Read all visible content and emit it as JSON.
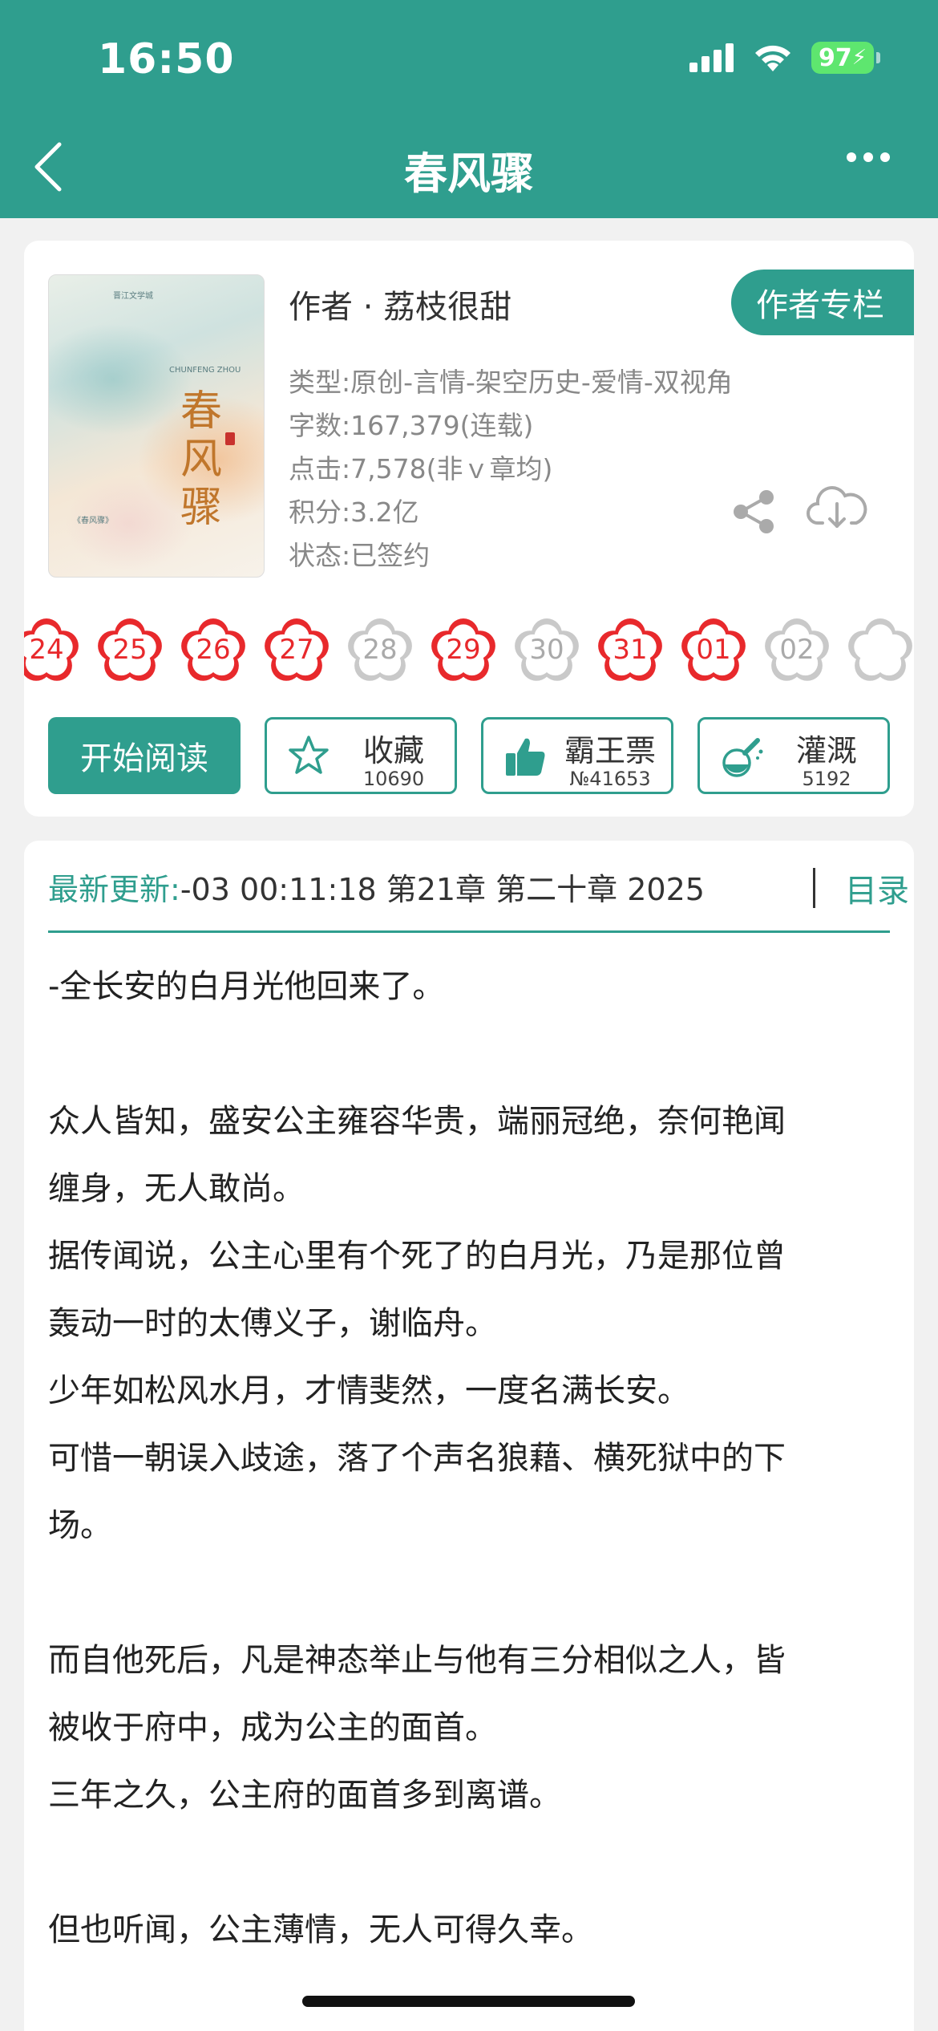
{
  "status_bar": {
    "time": "16:50",
    "battery": "97"
  },
  "nav": {
    "title": "春风骤"
  },
  "cover": {
    "title_chars": [
      "春",
      "风",
      "骤"
    ],
    "tiny_text_1": "晋江文学城",
    "tiny_text_2": "CHUNFENG ZHOU",
    "tiny_text_3": "《春风骤》"
  },
  "book": {
    "author": "作者 · 荔枝很甜",
    "author_tag": "作者专栏",
    "meta": [
      "类型:原创-言情-架空历史-爱情-双视角",
      "字数:167,379(连载)",
      "点击:7,578(非ｖ章均)",
      "积分:3.2亿",
      "状态:已签约"
    ]
  },
  "calendar": [
    {
      "day": "24",
      "active": true
    },
    {
      "day": "25",
      "active": true
    },
    {
      "day": "26",
      "active": true
    },
    {
      "day": "27",
      "active": true
    },
    {
      "day": "28",
      "active": false
    },
    {
      "day": "29",
      "active": true
    },
    {
      "day": "30",
      "active": false
    },
    {
      "day": "31",
      "active": true
    },
    {
      "day": "01",
      "active": true
    },
    {
      "day": "02",
      "active": false
    }
  ],
  "actions": {
    "read": "开始阅读",
    "collect": {
      "label": "收藏",
      "count": "10690"
    },
    "ticket": {
      "label": "霸王票",
      "count": "№41653"
    },
    "water": {
      "label": "灌溉",
      "count": "5192"
    }
  },
  "update": {
    "label": "最新更新:",
    "text": "-03 00:11:18   第21章 第二十章 2025",
    "toc": "目录"
  },
  "intro": [
    "-全长安的白月光他回来了。",
    "",
    "众人皆知，盛安公主雍容华贵，端丽冠绝，奈何艳闻",
    "缠身，无人敢尚。",
    "据传闻说，公主心里有个死了的白月光，乃是那位曾",
    "轰动一时的太傅义子，谢临舟。",
    "少年如松风水月，才情斐然，一度名满长安。",
    "可惜一朝误入歧途，落了个声名狼藉、横死狱中的下",
    "场。",
    "",
    "而自他死后，凡是神态举止与他有三分相似之人，皆",
    "被收于府中，成为公主的面首。",
    "三年之久，公主府的面首多到离谱。",
    "",
    "但也听闻，公主薄情，无人可得久幸。"
  ],
  "colors": {
    "accent": "#2f9e8e",
    "flower_active": "#e8292c",
    "flower_inactive": "#c9c9c9"
  }
}
